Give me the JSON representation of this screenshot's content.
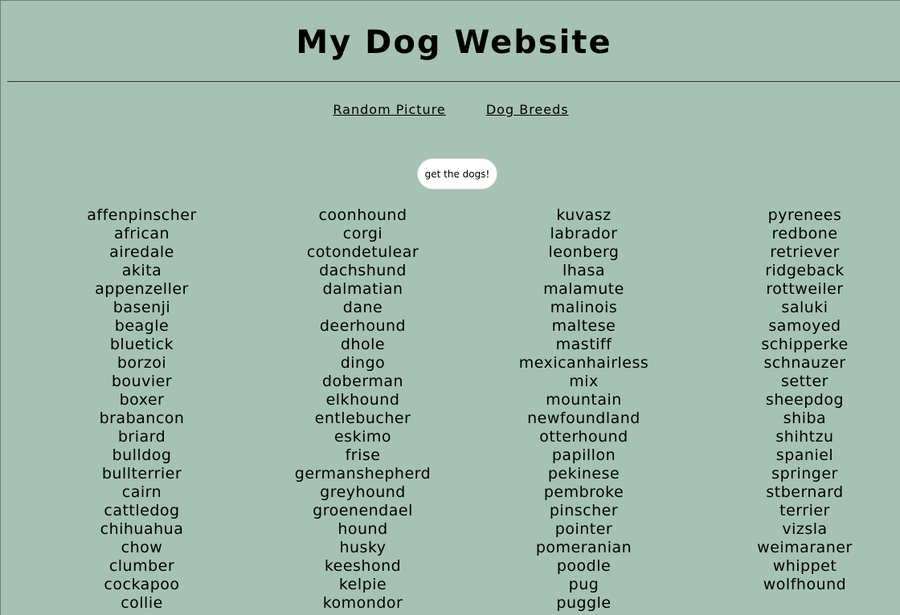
{
  "header": {
    "title": "My Dog Website"
  },
  "nav": {
    "items": [
      "Random Picture",
      "Dog Breeds"
    ]
  },
  "button": {
    "label": "get the dogs!"
  },
  "breeds": {
    "columns": [
      [
        "affenpinscher",
        "african",
        "airedale",
        "akita",
        "appenzeller",
        "basenji",
        "beagle",
        "bluetick",
        "borzoi",
        "bouvier",
        "boxer",
        "brabancon",
        "briard",
        "bulldog",
        "bullterrier",
        "cairn",
        "cattledog",
        "chihuahua",
        "chow",
        "clumber",
        "cockapoo",
        "collie"
      ],
      [
        "coonhound",
        "corgi",
        "cotondetulear",
        "dachshund",
        "dalmatian",
        "dane",
        "deerhound",
        "dhole",
        "dingo",
        "doberman",
        "elkhound",
        "entlebucher",
        "eskimo",
        "frise",
        "germanshepherd",
        "greyhound",
        "groenendael",
        "hound",
        "husky",
        "keeshond",
        "kelpie",
        "komondor"
      ],
      [
        "kuvasz",
        "labrador",
        "leonberg",
        "lhasa",
        "malamute",
        "malinois",
        "maltese",
        "mastiff",
        "mexicanhairless",
        "mix",
        "mountain",
        "newfoundland",
        "otterhound",
        "papillon",
        "pekinese",
        "pembroke",
        "pinscher",
        "pointer",
        "pomeranian",
        "poodle",
        "pug",
        "puggle"
      ],
      [
        "pyrenees",
        "redbone",
        "retriever",
        "ridgeback",
        "rottweiler",
        "saluki",
        "samoyed",
        "schipperke",
        "schnauzer",
        "setter",
        "sheepdog",
        "shiba",
        "shihtzu",
        "spaniel",
        "springer",
        "stbernard",
        "terrier",
        "vizsla",
        "weimaraner",
        "whippet",
        "wolfhound"
      ]
    ]
  }
}
